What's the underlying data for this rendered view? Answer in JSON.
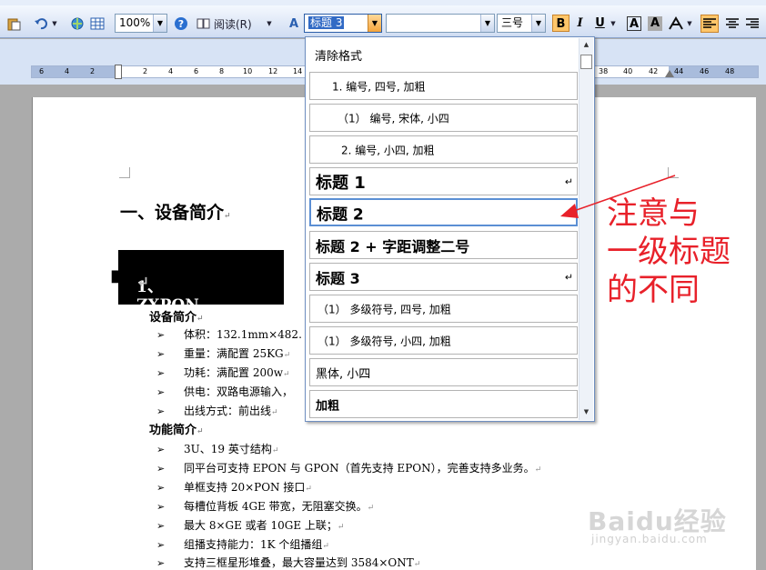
{
  "toolbar": {
    "zoom": "100%",
    "read_label": "阅读(R)",
    "style_value": "标题 3",
    "font_size": "三号",
    "bold": "B",
    "italic": "I",
    "underline": "U",
    "char_shade": "A",
    "char_border": "A"
  },
  "ruler": {
    "ticks": [
      "6",
      "4",
      "2",
      "2",
      "4",
      "6",
      "8",
      "10",
      "12",
      "14",
      "38",
      "40",
      "42",
      "44",
      "46",
      "48"
    ]
  },
  "style_dropdown": {
    "clear_label": "清除格式",
    "items": [
      {
        "label": "1.  编号, 四号, 加粗"
      },
      {
        "label": "（1）   编号, 宋体, 小四"
      },
      {
        "label": "2.  编号, 小四, 加粗"
      },
      {
        "label": "标题 1"
      },
      {
        "label": "标题 2"
      },
      {
        "label": "标题 2 + 字距调整二号"
      },
      {
        "label": "标题 3"
      },
      {
        "label": "（1）  多级符号, 四号, 加粗"
      },
      {
        "label": "（1）  多级符号, 小四, 加粗"
      },
      {
        "label": "黑体,  小四"
      },
      {
        "label": "加粗"
      }
    ]
  },
  "document": {
    "heading1": "一、设备简介",
    "heading2": "1、ZXPON C200",
    "section1_title": "设备简介",
    "section1_items": [
      "体积：132.1mm×482.",
      "重量：满配置 25KG",
      "功耗：满配置 200w",
      "供电：双路电源输入，",
      "出线方式：前出线"
    ],
    "section2_title": "功能简介",
    "section2_items": [
      "3U、19 英寸结构",
      "同平台可支持 EPON 与 GPON（首先支持 EPON），完善支持多业务。",
      "单框支持 20×PON 接口",
      "每槽位背板 4GE 带宽，无阻塞交换。",
      "最大 8×GE 或者 10GE 上联；",
      "组播支持能力：1K 个组播组",
      "支持三框星形堆叠，最大容量达到 3584×ONT"
    ]
  },
  "annotation": {
    "lines": [
      "注意与",
      "一级标题",
      "的不同"
    ],
    "color": "#e8212a"
  },
  "watermark": {
    "main": "Baidu经验",
    "sub": "jingyan.baidu.com"
  }
}
